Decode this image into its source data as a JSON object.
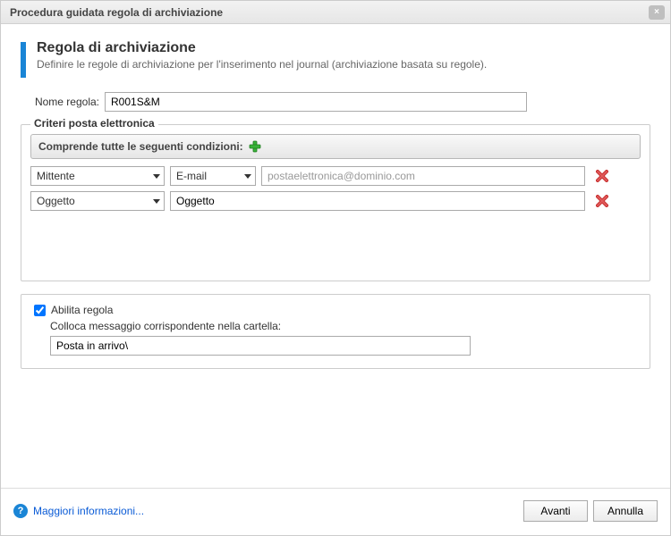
{
  "window": {
    "title": "Procedura guidata regola di archiviazione"
  },
  "header": {
    "title": "Regola di archiviazione",
    "subtitle": "Definire le regole di archiviazione per l'inserimento nel journal (archiviazione basata su regole)."
  },
  "rule_name": {
    "label": "Nome regola:",
    "value": "R001S&M"
  },
  "criteria": {
    "legend": "Criteri posta elettronica",
    "match_label": "Comprende tutte le seguenti condizioni:",
    "rows": [
      {
        "field": "Mittente",
        "attr": "E-mail",
        "value": "",
        "placeholder": "postaelettronica@dominio.com"
      },
      {
        "field": "Oggetto",
        "attr": null,
        "value": "Oggetto",
        "placeholder": ""
      }
    ]
  },
  "enable": {
    "checked": true,
    "label": "Abilita regola",
    "folder_label": "Colloca messaggio corrispondente nella cartella:",
    "folder_value": "Posta in arrivo\\"
  },
  "footer": {
    "help": "Maggiori informazioni...",
    "next": "Avanti",
    "cancel": "Annulla"
  },
  "icons": {
    "close": "×",
    "help": "?"
  }
}
